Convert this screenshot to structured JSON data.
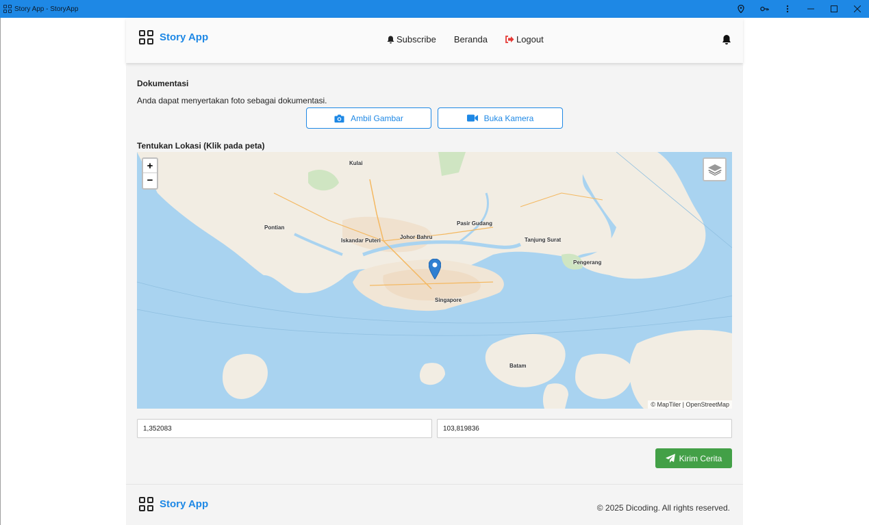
{
  "window": {
    "title": "Story App - StoryApp",
    "icons": [
      "location-pin-icon",
      "key-icon",
      "kebab-menu-icon",
      "minimize-icon",
      "maximize-icon",
      "close-icon"
    ]
  },
  "header": {
    "brand": "Story App",
    "nav": {
      "subscribe": "Subscribe",
      "home": "Beranda",
      "logout": "Logout"
    }
  },
  "form": {
    "doc_title": "Dokumentasi",
    "doc_desc": "Anda dapat menyertakan foto sebagai dokumentasi.",
    "take_picture": "Ambil Gambar",
    "open_camera": "Buka Kamera",
    "location_title": "Tentukan Lokasi (Klik pada peta)",
    "latitude": "1,352083",
    "longitude": "103,819836",
    "submit": "Kirim Cerita"
  },
  "map": {
    "zoom_in": "+",
    "zoom_out": "−",
    "attribution": "© MapTiler | OpenStreetMap",
    "labels": {
      "kulai": "Kulai",
      "pontian": "Pontian",
      "johor_bahru": "Johor Bahru",
      "iskandar_puteri": "Iskandar Puteri",
      "pasir_gudang": "Pasir Gudang",
      "singapore": "Singapore",
      "batam": "Batam",
      "pengerang": "Pengerang",
      "tanjung_surat": "Tanjung Surat"
    }
  },
  "footer": {
    "brand": "Story App",
    "copyright": "© 2025 Dicoding. All rights reserved."
  },
  "colors": {
    "titlebar": "#1e88e5",
    "brand": "#1e88e5",
    "logout_icon": "#e53935",
    "submit": "#43a047",
    "water": "#a9d3f0",
    "land": "#f2ede3",
    "pin": "#2f7fd1"
  }
}
